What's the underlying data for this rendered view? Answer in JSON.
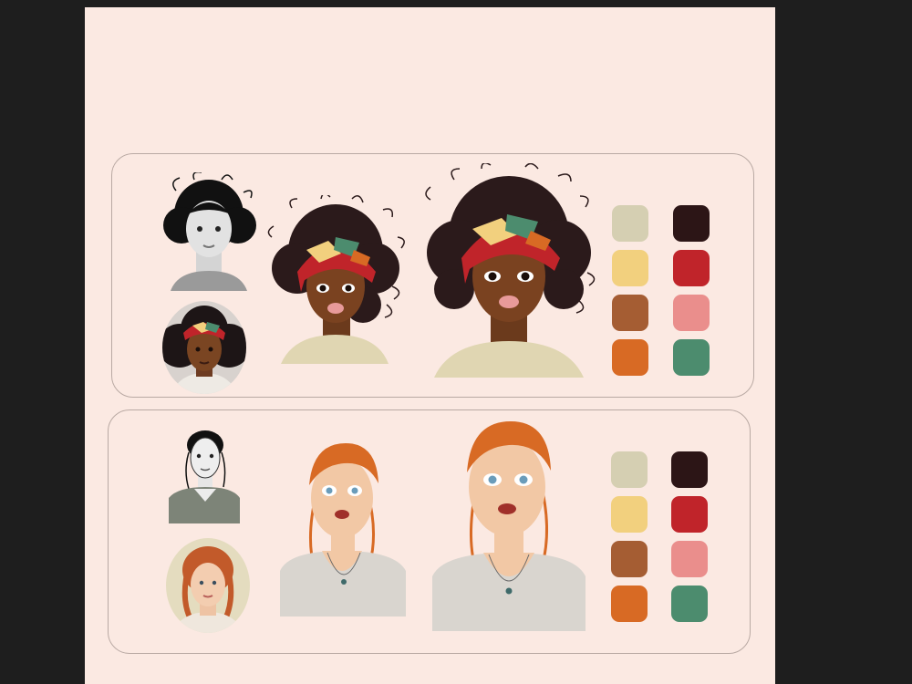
{
  "palette": {
    "colors": {
      "beige": "#d5cfb2",
      "yellow": "#f2d07e",
      "brown": "#a55d33",
      "orange": "#d86a24",
      "dark": "#2c1516",
      "red": "#c0242a",
      "pink": "#ea8e8c",
      "green": "#4c8c6e"
    }
  },
  "figures": {
    "woman_1": {
      "hair": "#2b1a1b",
      "skin": "#7a4220",
      "scarf": [
        "#c0242a",
        "#f2d07e",
        "#4c8c6e",
        "#d86a24"
      ],
      "shirt": "#e0d6b2"
    },
    "woman_2": {
      "hair": "#d86a24",
      "skin": "#f2c8a5",
      "shirt": "#d9d5cf"
    }
  }
}
